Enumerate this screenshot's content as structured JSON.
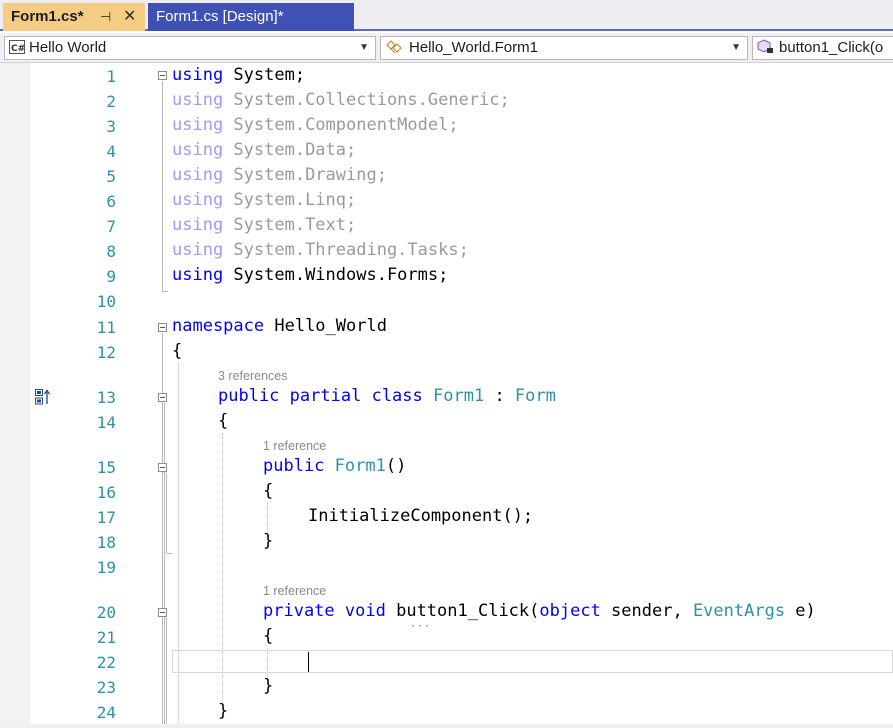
{
  "tabs": {
    "active": {
      "label": "Form1.cs*",
      "pin_glyph": "⊣",
      "close_glyph": "✕"
    },
    "inactive": {
      "label": "Form1.cs [Design]*"
    }
  },
  "navbar": {
    "project": "Hello World",
    "class": "Hello_World.Form1",
    "member": "button1_Click(o"
  },
  "code_lens": {
    "class_refs": "3 references",
    "ctor_refs": "1 reference",
    "method_refs": "1 reference"
  },
  "lines": [
    {
      "n": "1"
    },
    {
      "n": "2"
    },
    {
      "n": "3"
    },
    {
      "n": "4"
    },
    {
      "n": "5"
    },
    {
      "n": "6"
    },
    {
      "n": "7"
    },
    {
      "n": "8"
    },
    {
      "n": "9"
    },
    {
      "n": "10"
    },
    {
      "n": "11"
    },
    {
      "n": "12"
    },
    {
      "n": "13"
    },
    {
      "n": "14"
    },
    {
      "n": "15"
    },
    {
      "n": "16"
    },
    {
      "n": "17"
    },
    {
      "n": "18"
    },
    {
      "n": "19"
    },
    {
      "n": "20"
    },
    {
      "n": "21"
    },
    {
      "n": "22"
    },
    {
      "n": "23"
    },
    {
      "n": "24"
    }
  ],
  "code": {
    "kw_using": "using",
    "kw_namespace": "namespace",
    "kw_public": "public",
    "kw_partial": "partial",
    "kw_class": "class",
    "kw_private": "private",
    "kw_void": "void",
    "kw_object": "object",
    "l1": " System;",
    "l2": " System.Collections.Generic;",
    "l3": " System.ComponentModel;",
    "l4": " System.Data;",
    "l5": " System.Drawing;",
    "l6": " System.Linq;",
    "l7": " System.Text;",
    "l8": " System.Threading.Tasks;",
    "l9": " System.Windows.Forms;",
    "l11": " Hello_World",
    "open_brace": "{",
    "close_brace": "}",
    "form1": "Form1",
    "colon": " : ",
    "form": "Form",
    "ctor_parens": "()",
    "l17": "InitializeComponent();",
    "method_name": " button1_Click(",
    "sender": " sender, ",
    "eventargs": "EventArgs",
    "e": " e)"
  },
  "colors": {
    "keyword": "#0000ff",
    "type": "#2b91af",
    "line_number": "#2b91af",
    "tab_active": "#f5cc84",
    "tab_inactive": "#3f51b5"
  }
}
